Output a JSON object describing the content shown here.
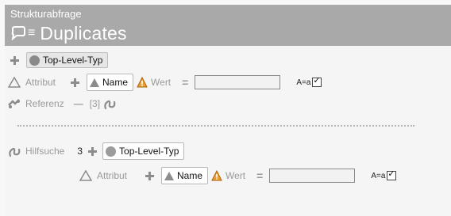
{
  "header": {
    "subtitle": "Strukturabfrage",
    "title": "Duplicates",
    "lines_glyph": "≡"
  },
  "row1": {
    "chip_label": "Top-Level-Typ"
  },
  "attribut": {
    "label": "Attribut",
    "name_chip": "Name",
    "wert_label": "Wert",
    "eq": "=",
    "value": "",
    "case_label": "A=a",
    "case_checked": true
  },
  "referenz": {
    "label": "Referenz",
    "minus": "—",
    "count": "[3]"
  },
  "hilfsuche": {
    "label": "Hilfsuche",
    "number": "3",
    "chip_label": "Top-Level-Typ"
  },
  "sub_attribut": {
    "label": "Attribut",
    "name_chip": "Name",
    "wert_label": "Wert",
    "eq": "=",
    "value": "",
    "case_label": "A=a",
    "case_checked": true
  },
  "colors": {
    "header_bg": "#a9a9a9",
    "warning": "#d38b1a"
  },
  "icons": [
    "chat-bubble-icon",
    "plus-icon",
    "circle-icon",
    "triangle-icon",
    "warning-icon",
    "tentacle-icon",
    "link-icon"
  ]
}
